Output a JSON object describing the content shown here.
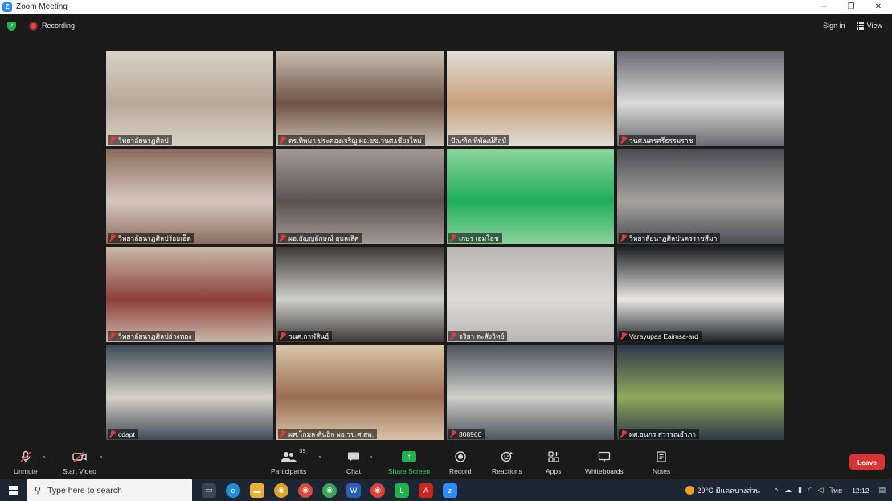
{
  "window": {
    "title": "Zoom Meeting",
    "minimize": "─",
    "maximize": "❐",
    "close": "✕"
  },
  "topbar": {
    "recording_label": "Recording",
    "sign_in": "Sign in",
    "view_label": "View"
  },
  "participants": [
    {
      "name": "วิทยาลัยนาฏศิลป",
      "muted": true,
      "bg": "#b7a99a",
      "bg2": "#d9d2c4"
    },
    {
      "name": "ดร.ทิพมา ประคองเจริญ ผอ.ขข.วนศ.เชียงใหม่",
      "muted": true,
      "bg": "#6e5346",
      "bg2": "#c8bdb0"
    },
    {
      "name": "ปัณฑิต พิพัฒน์ศิลป์",
      "muted": false,
      "bg": "#c9a07a",
      "bg2": "#e0ddd8"
    },
    {
      "name": "วนศ.นครศรีธรรมราช",
      "muted": true,
      "bg": "#d9dad8",
      "bg2": "#6b6a73"
    },
    {
      "name": "วิทยาลัยนาฏศิลปร้อยเอ็ด",
      "muted": true,
      "bg": "#d8c7bf",
      "bg2": "#8a6d5c"
    },
    {
      "name": "ผอ.ธัญญลักษณ์ อุบลเลิศ",
      "muted": true,
      "bg": "#5c5350",
      "bg2": "#a39994"
    },
    {
      "name": "เกษร เอมโอช",
      "muted": true,
      "bg": "#1fae5b",
      "bg2": "#8bd39c"
    },
    {
      "name": "วิทยาลัยนาฏศิลปนครราชสีมา",
      "muted": true,
      "bg": "#a5a39c",
      "bg2": "#4b4d55"
    },
    {
      "name": "วิทยาลัยนาฏศิลปอ่างทอง",
      "muted": true,
      "bg": "#8e3f3c",
      "bg2": "#c9b9a8"
    },
    {
      "name": "วนศ.กาฬสินธุ์",
      "muted": true,
      "bg": "#cfcfcb",
      "bg2": "#3d3b3a"
    },
    {
      "name": "จริยา ตะสังวิทย์",
      "muted": true,
      "bg": "#dcdad7",
      "bg2": "#b8b5b2"
    },
    {
      "name": "Varayupas Eaimsa-ard",
      "muted": true,
      "bg": "#e9e6e4",
      "bg2": "#1f2226"
    },
    {
      "name": "cdapt",
      "muted": true,
      "bg": "#d7d1c6",
      "bg2": "#3f4a58"
    },
    {
      "name": "ผศ.โกมล คันธิก ผอ.วข.ศ.สพ.",
      "muted": true,
      "bg": "#9a6d51",
      "bg2": "#d9c4a7"
    },
    {
      "name": "308960",
      "muted": true,
      "bg": "#cfcfc9",
      "bg2": "#4d545c"
    },
    {
      "name": "ผศ.ธนกร สุวรรณอำภา",
      "muted": true,
      "bg": "#8fa85b",
      "bg2": "#2d3949"
    }
  ],
  "toolbar": {
    "unmute": "Unmute",
    "start_video": "Start Video",
    "participants": "Participants",
    "participants_count": "39",
    "chat": "Chat",
    "share_screen": "Share Screen",
    "record": "Record",
    "reactions": "Reactions",
    "apps": "Apps",
    "whiteboards": "Whiteboards",
    "notes": "Notes",
    "leave": "Leave"
  },
  "taskbar": {
    "search_placeholder": "Type here to search",
    "temperature": "29°C",
    "weather_text": "มีแดดบางส่วน",
    "language": "ไทย",
    "time": "12:12"
  },
  "colors": {
    "active_speaker": "#a6f04a",
    "share_green": "#22b14c",
    "leave_red": "#d83434"
  }
}
